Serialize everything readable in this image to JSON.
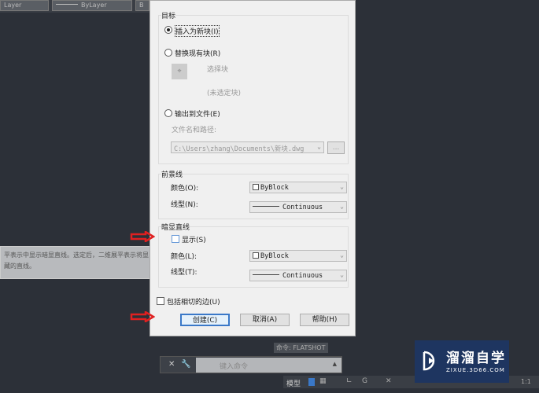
{
  "toolbar": {
    "layer1": "Layer",
    "layer2": "ByLayer",
    "layer3": "B"
  },
  "dialog": {
    "target": {
      "title": "目标",
      "insert_new": "插入为新块(I)",
      "replace": "替换现有块(R)",
      "select_block": "选择块",
      "no_block": "(未选定块)",
      "export_file": "输出到文件(E)",
      "file_path_label": "文件名和路径:",
      "file_path": "C:\\Users\\zhang\\Documents\\新块.dwg",
      "browse": "..."
    },
    "foreground": {
      "title": "前景线",
      "color_label": "颜色(O):",
      "color_value": "ByBlock",
      "linetype_label": "线型(N):",
      "linetype_value": "Continuous"
    },
    "obscured": {
      "title": "暗显直线",
      "show_label": "显示(S)",
      "color_label": "颜色(L):",
      "color_value": "ByBlock",
      "linetype_label": "线型(T):",
      "linetype_value": "Continuous"
    },
    "include_tangent": "包括相切的边(U)",
    "buttons": {
      "create": "创建(C)",
      "cancel": "取消(A)",
      "help": "帮助(H)"
    }
  },
  "tooltip": {
    "line1": "平表示中显示暗显直线。选定后，二维展平表示将显",
    "line2": "藏的直线。"
  },
  "command": {
    "history": "命令: FLATSHOT",
    "placeholder": "键入命令"
  },
  "status": {
    "model": "模型",
    "scale": "1:1"
  },
  "watermark": {
    "name": "溜溜自学",
    "url": "ZIXUE.3D66.COM"
  },
  "colors": {
    "arrow": "#e02020",
    "accent": "#3a78c8"
  }
}
